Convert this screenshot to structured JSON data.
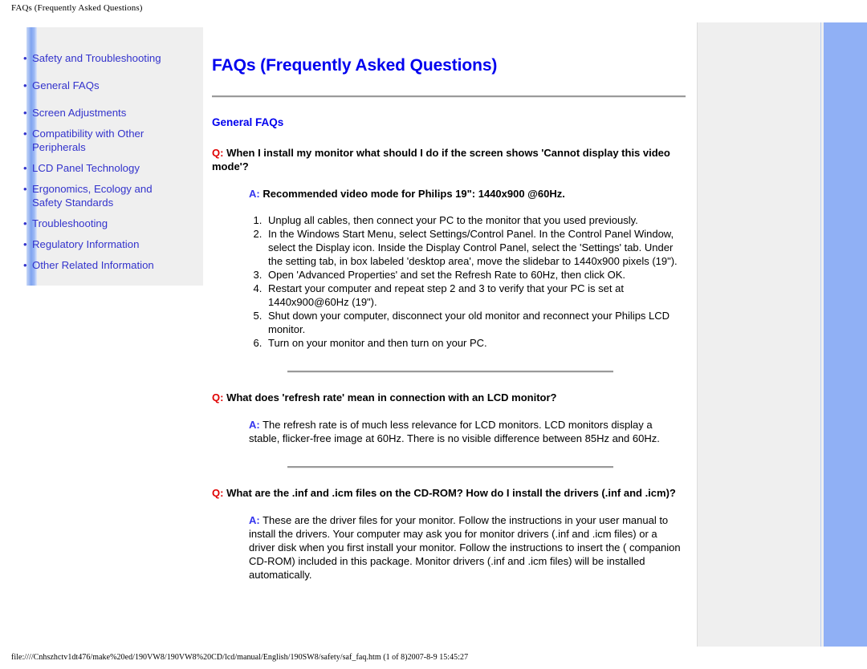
{
  "browser": {
    "header_title": "FAQs (Frequently Asked Questions)",
    "footer_path": "file:////Cnhszhctv1dt476/make%20ed/190VW8/190VW8%20CD/lcd/manual/English/190SW8/safety/saf_faq.htm (1 of 8)2007-8-9 15:45:27"
  },
  "sidebar": {
    "items": [
      {
        "label": "Safety and Troubleshooting"
      },
      {
        "label": "General FAQs"
      },
      {
        "label": "Screen Adjustments"
      },
      {
        "label": "Compatibility with Other Peripherals"
      },
      {
        "label": "LCD Panel Technology"
      },
      {
        "label": "Ergonomics, Ecology and Safety Standards"
      },
      {
        "label": "Troubleshooting"
      },
      {
        "label": "Regulatory Information"
      },
      {
        "label": "Other Related Information"
      }
    ]
  },
  "main": {
    "page_title": "FAQs (Frequently Asked Questions)",
    "section_title": "General FAQs",
    "qa": [
      {
        "q_marker": "Q:",
        "question": "When I install my monitor what should I do if the screen shows 'Cannot display this video mode'?",
        "a_marker": "A:",
        "answer": "Recommended video mode for Philips 19\": 1440x900 @60Hz.",
        "steps": [
          "Unplug all cables, then connect your PC to the monitor that you used previously.",
          "In the Windows Start Menu, select Settings/Control Panel. In the Control Panel Window, select the Display icon. Inside the Display Control Panel, select the 'Settings' tab. Under the setting tab, in box labeled 'desktop area', move the slidebar to 1440x900 pixels (19\").",
          "Open 'Advanced Properties' and set the Refresh Rate to 60Hz, then click OK.",
          "Restart your computer and repeat step 2 and 3 to verify that your PC is set at 1440x900@60Hz (19\").",
          "Shut down your computer, disconnect your old monitor and reconnect your Philips LCD monitor.",
          "Turn on your monitor and then turn on your PC."
        ]
      },
      {
        "q_marker": "Q:",
        "question": "What does 'refresh rate' mean in connection with an LCD monitor?",
        "a_marker": "A:",
        "answer": "The refresh rate is of much less relevance for LCD monitors. LCD monitors display a stable, flicker-free image at 60Hz. There is no visible difference between 85Hz and 60Hz."
      },
      {
        "q_marker": "Q:",
        "question": "What are the .inf and .icm files on the CD-ROM? How do I install the drivers (.inf and .icm)?",
        "a_marker": "A:",
        "answer": "These are the driver files for your monitor. Follow the instructions in your user manual to install the drivers. Your computer may ask you for monitor drivers (.inf and .icm files) or a driver disk when you first install your monitor. Follow the instructions to insert the ( companion CD-ROM) included in this package. Monitor drivers (.inf and .icm files) will be installed automatically."
      }
    ]
  },
  "colors": {
    "link_blue": "#3333cc",
    "title_blue": "#0000ee",
    "q_red": "#e00000",
    "a_blue": "#3333ee",
    "panel_gray": "#efefef",
    "accent_blue": "#90b0f5"
  }
}
